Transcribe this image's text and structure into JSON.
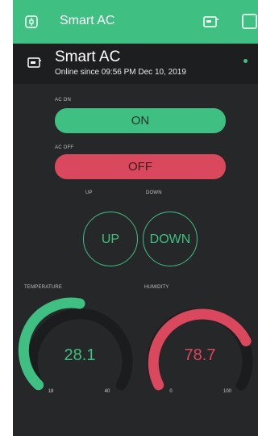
{
  "app": {
    "title": "Smart AC",
    "icons": [
      "chip-icon",
      "device-icon",
      "square-icon"
    ]
  },
  "device": {
    "name": "Smart AC",
    "status": "Online since 09:56 PM Dec 10, 2019",
    "icon": "device-icon"
  },
  "controls": {
    "on_label": "AC ON",
    "on_button": "ON",
    "off_label": "AC OFF",
    "off_button": "OFF",
    "up_label": "UP",
    "up_button": "UP",
    "down_label": "DOWN",
    "down_button": "DOWN"
  },
  "gauges": {
    "temperature": {
      "label": "TEMPERATURE",
      "value": "28.1",
      "min": "18",
      "max": "40"
    },
    "humidity": {
      "label": "HUMIDITY",
      "value": "78.7",
      "min": "0",
      "max": "100"
    }
  },
  "colors": {
    "accent_green": "#3fc082",
    "accent_red": "#d9485d",
    "background": "#262728"
  }
}
